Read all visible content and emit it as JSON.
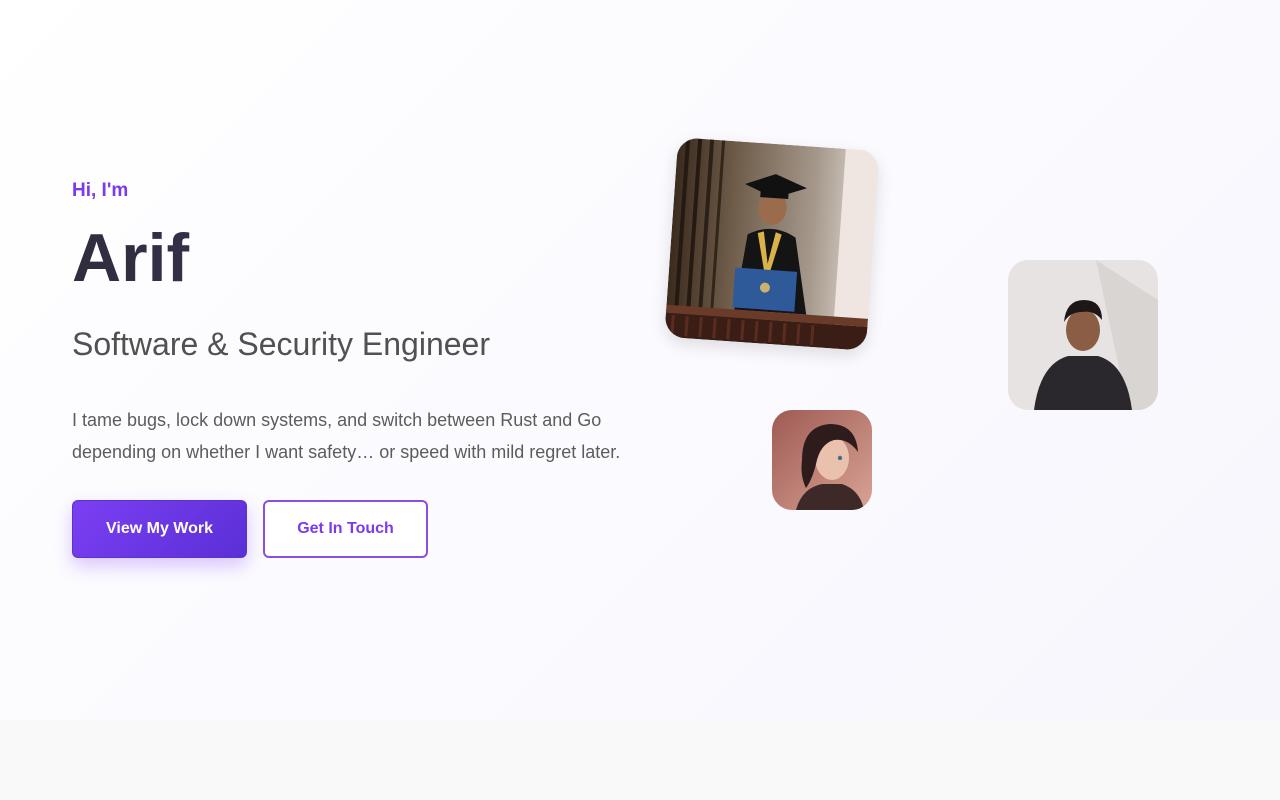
{
  "hero": {
    "greeting": "Hi, I'm",
    "name": "Arif",
    "role": "Software & Security Engineer",
    "bio": "I tame bugs, lock down systems, and switch between Rust and Go depending on whether I want safety… or speed with mild regret later.",
    "primary_cta": "View My Work",
    "secondary_cta": "Get In Touch"
  },
  "colors": {
    "accent": "#7c3aed",
    "name_text": "#3a3350",
    "role_text": "#515151",
    "body_text": "#5c5c5c"
  },
  "images": {
    "graduation_photo": "photo-of-graduate-in-cap-and-gown-holding-diploma",
    "portrait_photo": "photo-of-person-in-dark-hoodie",
    "avatar": "illustrated-character-avatar"
  }
}
